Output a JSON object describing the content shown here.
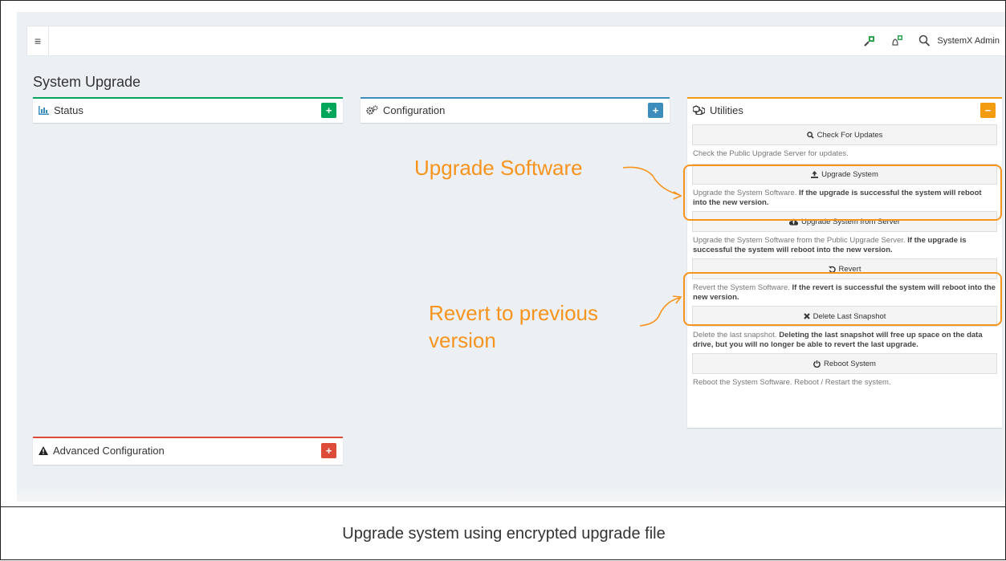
{
  "topbar": {
    "user_name": "SystemX Admin"
  },
  "page": {
    "title": "System Upgrade"
  },
  "panels": {
    "status": {
      "title": "Status",
      "tool": "+"
    },
    "configuration": {
      "title": "Configuration",
      "tool": "+"
    },
    "advanced": {
      "title": "Advanced Configuration",
      "tool": "+"
    },
    "utilities": {
      "title": "Utilities",
      "tool": "−",
      "items": [
        {
          "label": "Check For Updates",
          "desc_plain": "Check the Public Upgrade Server for updates.",
          "desc_bold": ""
        },
        {
          "label": "Upgrade System",
          "desc_plain": "Upgrade the System Software. ",
          "desc_bold": "If the upgrade is successful the system will reboot into the new version."
        },
        {
          "label": "Upgrade System from Server",
          "desc_plain": "Upgrade the System Software from the Public Upgrade Server. ",
          "desc_bold": "If the upgrade is successful the system will reboot into the new version."
        },
        {
          "label": "Revert",
          "desc_plain": "Revert the System Software. ",
          "desc_bold": "If the revert is successful the system will reboot into the new version."
        },
        {
          "label": "Delete Last Snapshot",
          "desc_plain": "Delete the last snapshot. ",
          "desc_bold": "Deleting the last snapshot will free up space on the data drive, but you will no longer be able to revert the last upgrade."
        },
        {
          "label": "Reboot System",
          "desc_plain": "Reboot the System Software. Reboot / Restart the system.",
          "desc_bold": ""
        }
      ]
    }
  },
  "annotations": {
    "upgrade": "Upgrade Software",
    "revert_line1": "Revert to previous",
    "revert_line2": "version",
    "color": "#f7941d"
  },
  "caption": "Upgrade system using encrypted upgrade file",
  "colors": {
    "green": "#00a65a",
    "blue": "#3c8dbc",
    "orange": "#f39c12",
    "red": "#dd4b39"
  }
}
